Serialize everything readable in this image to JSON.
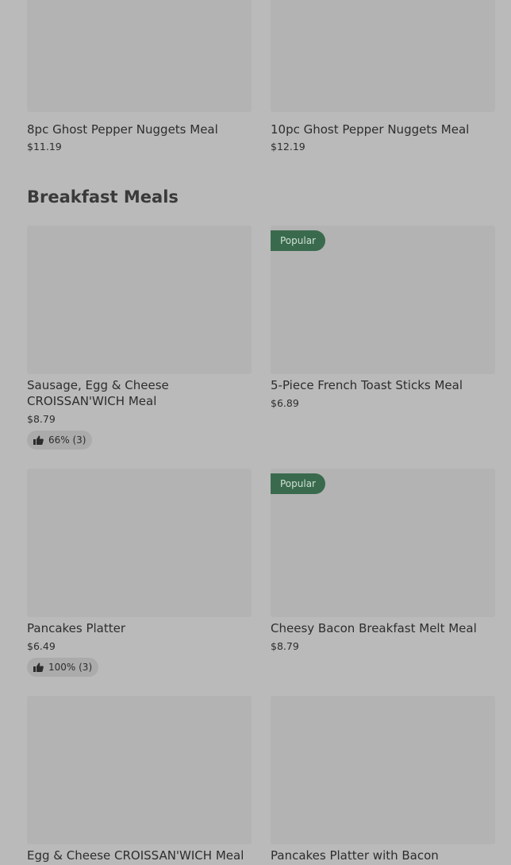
{
  "top_row": [
    {
      "name": "8pc Ghost Pepper Nuggets Meal",
      "price": "$11.19"
    },
    {
      "name": "10pc Ghost Pepper Nuggets Meal",
      "price": "$12.19"
    }
  ],
  "section": {
    "title": "Breakfast Meals"
  },
  "items": [
    {
      "name_line1": "Sausage, Egg & Cheese",
      "name_line2": "CROISSAN'WICH Meal",
      "price": "$8.79",
      "rating": "66% (3)"
    },
    {
      "name": "5-Piece French Toast Sticks Meal",
      "price": "$6.89",
      "badge": "Popular"
    },
    {
      "name": "Pancakes Platter",
      "price": "$6.49",
      "rating": "100% (3)"
    },
    {
      "name": "Cheesy Bacon Breakfast Melt Meal",
      "price": "$8.79",
      "badge": "Popular"
    },
    {
      "name": "Egg & Cheese CROISSAN'WICH Meal"
    },
    {
      "name": "Pancakes Platter with Bacon"
    }
  ],
  "icons": {
    "rating": "thumbs-up-icon"
  },
  "colors": {
    "badge_bg": "#3a6a4d",
    "page_bg": "#bababa"
  }
}
